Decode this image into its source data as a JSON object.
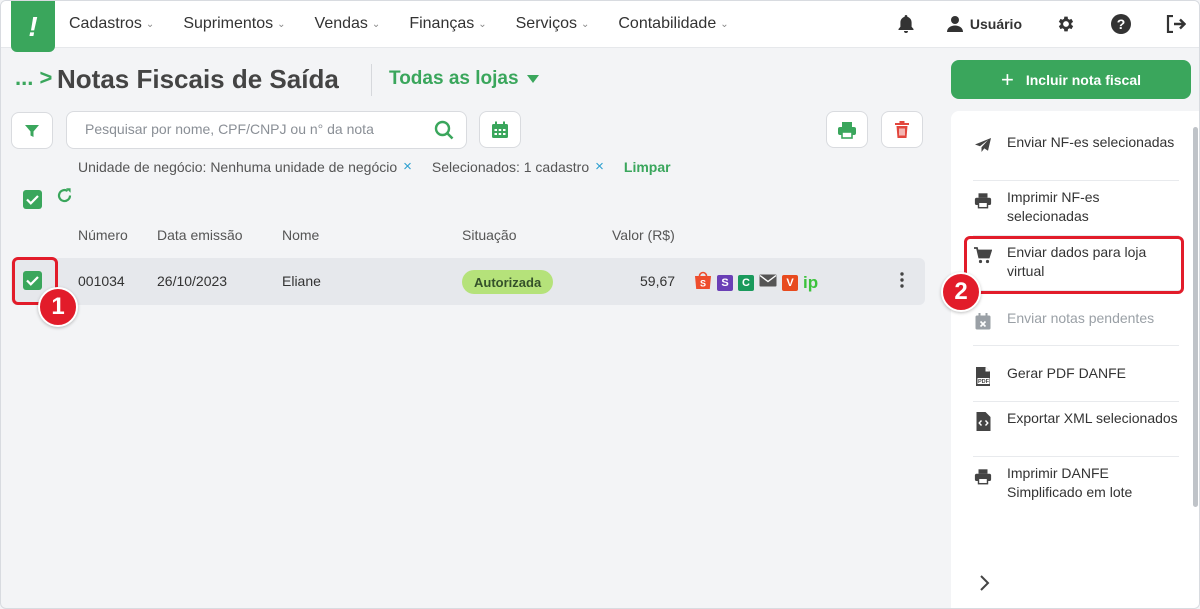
{
  "nav": {
    "logo": "!",
    "items": [
      {
        "label": "Cadastros"
      },
      {
        "label": "Suprimentos"
      },
      {
        "label": "Vendas"
      },
      {
        "label": "Finanças"
      },
      {
        "label": "Serviços"
      },
      {
        "label": "Contabilidade"
      }
    ],
    "user_label": "Usuário"
  },
  "header": {
    "breadcrumb": "... >",
    "title": "Notas Fiscais de Saída",
    "store_selector": "Todas as lojas"
  },
  "search": {
    "placeholder": "Pesquisar por nome, CPF/CNPJ ou n° da nota",
    "value": ""
  },
  "filters": {
    "business_unit": "Unidade de negócio: Nenhuma unidade de negócio",
    "selected": "Selecionados: 1 cadastro",
    "clear_label": "Limpar",
    "remove_glyph": "×"
  },
  "table": {
    "columns": [
      "Número",
      "Data emissão",
      "Nome",
      "Situação",
      "Valor (R$)"
    ],
    "rows": [
      {
        "numero": "001034",
        "data": "26/10/2023",
        "nome": "Eliane",
        "situacao": "Autorizada",
        "valor": "59,67",
        "checked": true,
        "integrations": [
          "shopee-icon",
          "s-icon",
          "c-icon",
          "mail-icon",
          "v-icon",
          "ip-icon"
        ]
      }
    ]
  },
  "integration_labels": {
    "s": "S",
    "c": "C",
    "v": "V",
    "ip": "ip"
  },
  "actions": {
    "include_label": "Incluir nota fiscal",
    "items": [
      {
        "label": "Enviar NF-es selecionadas",
        "icon": "send-icon",
        "enabled": true
      },
      {
        "label": "Imprimir NF-es selecionadas",
        "icon": "printer-icon",
        "enabled": true
      },
      {
        "label": "Enviar dados para loja virtual",
        "icon": "cart-icon",
        "enabled": true
      },
      {
        "label": "Enviar notas pendentes",
        "icon": "calendar-x-icon",
        "enabled": false
      },
      {
        "label": "Gerar PDF DANFE",
        "icon": "pdf-file-icon",
        "enabled": true
      },
      {
        "label": "Exportar XML selecionados",
        "icon": "code-file-icon",
        "enabled": true
      },
      {
        "label": "Imprimir DANFE Simplificado em lote",
        "icon": "printer-icon",
        "enabled": true
      }
    ]
  },
  "steps": {
    "one": "1",
    "two": "2"
  },
  "colors": {
    "brand_green": "#3aa65c",
    "highlight_red": "#e21c2a",
    "status_badge": "#b5e27a",
    "delete_red": "#e2463d"
  }
}
